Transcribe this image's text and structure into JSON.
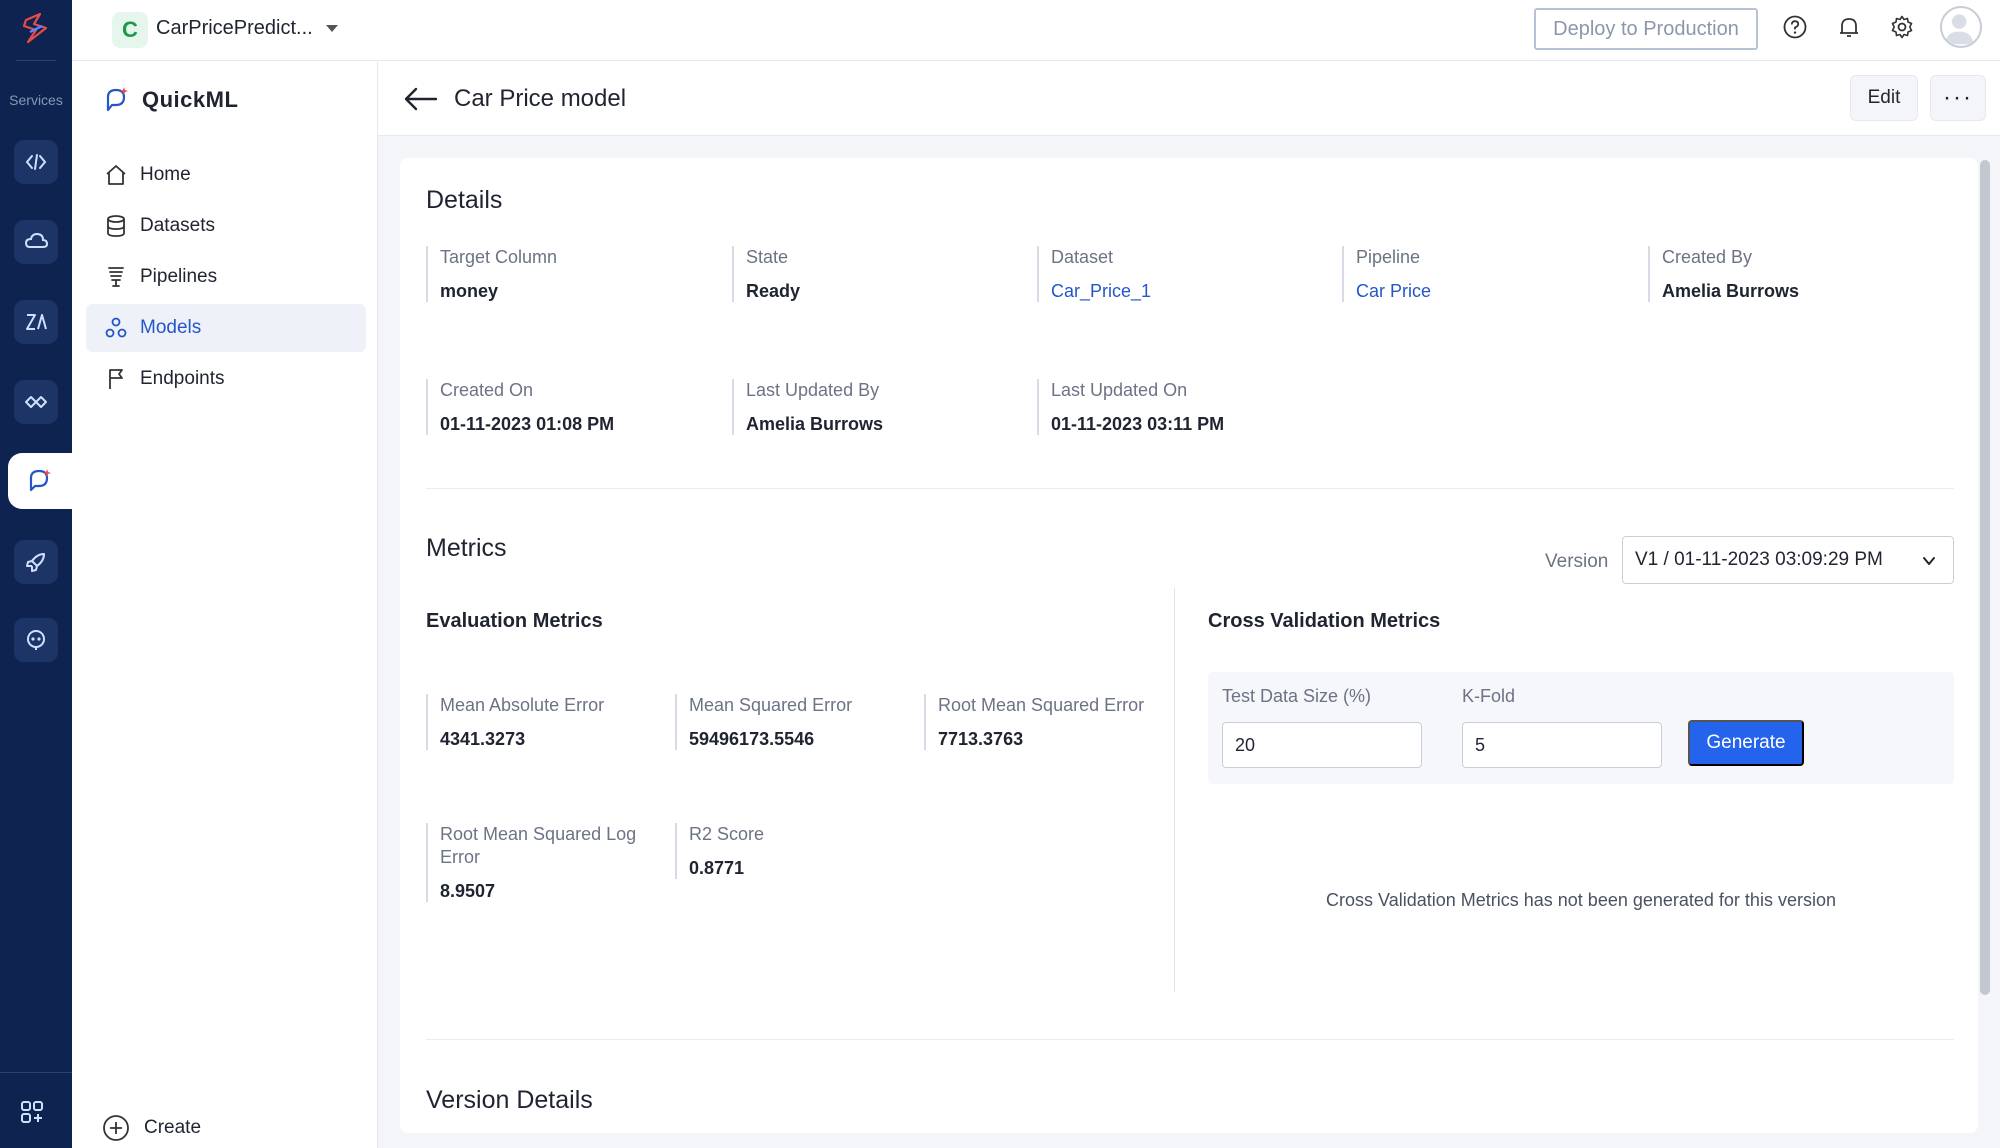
{
  "rail": {
    "label": "Services",
    "icons": [
      "code-icon",
      "cloud-icon",
      "analytics-icon",
      "integration-icon",
      "quickml-icon",
      "rocket-icon",
      "bot-icon"
    ]
  },
  "topbar": {
    "project_initial": "C",
    "project_name": "CarPricePredict...",
    "deploy_label": "Deploy to Production"
  },
  "sidepanel": {
    "brand": "QuickML",
    "nav": [
      {
        "label": "Home",
        "icon": "home-icon"
      },
      {
        "label": "Datasets",
        "icon": "database-icon"
      },
      {
        "label": "Pipelines",
        "icon": "pipeline-icon"
      },
      {
        "label": "Models",
        "icon": "models-icon",
        "active": true
      },
      {
        "label": "Endpoints",
        "icon": "flag-icon"
      }
    ],
    "create_label": "Create"
  },
  "header": {
    "title": "Car Price model",
    "edit_label": "Edit",
    "more_label": "···"
  },
  "details": {
    "title": "Details",
    "fields": [
      {
        "label": "Target Column",
        "value": "money"
      },
      {
        "label": "State",
        "value": "Ready"
      },
      {
        "label": "Dataset",
        "value": "Car_Price_1"
      },
      {
        "label": "Pipeline",
        "value": "Car Price"
      },
      {
        "label": "Created By",
        "value": "Amelia Burrows"
      },
      {
        "label": "Created On",
        "value": "01-11-2023 01:08 PM"
      },
      {
        "label": "Last Updated By",
        "value": "Amelia Burrows"
      },
      {
        "label": "Last Updated On",
        "value": "01-11-2023 03:11 PM"
      }
    ]
  },
  "metrics": {
    "title": "Metrics",
    "version_label": "Version",
    "version_value": "V1 / 01-11-2023 03:09:29 PM",
    "evaluation": {
      "title": "Evaluation Metrics",
      "items": [
        {
          "label": "Mean Absolute Error",
          "value": "4341.3273"
        },
        {
          "label": "Mean Squared Error",
          "value": "59496173.5546"
        },
        {
          "label": "Root Mean Squared Error",
          "value": "7713.3763"
        },
        {
          "label": "Root Mean Squared Log Error",
          "value": "8.9507"
        },
        {
          "label": "R2 Score",
          "value": "0.8771"
        }
      ]
    },
    "cross_validation": {
      "title": "Cross Validation Metrics",
      "test_size_label": "Test Data Size (%)",
      "test_size_value": "20",
      "kfold_label": "K-Fold",
      "kfold_value": "5",
      "generate_label": "Generate",
      "empty_message": "Cross Validation Metrics has not been generated for this version"
    }
  },
  "version_details": {
    "title": "Version Details"
  }
}
